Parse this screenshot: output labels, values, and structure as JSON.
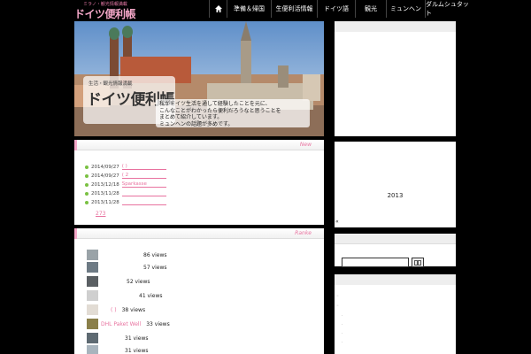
{
  "header": {
    "logo_sub": "ミラノ・観光情報満載",
    "logo_main": "ドイツ便利帳",
    "nav": [
      {
        "label": "準備＆帰国"
      },
      {
        "label": "生便利活情報"
      },
      {
        "label": "ドイツ語"
      },
      {
        "label": "観光"
      },
      {
        "label": "ミュンヘン"
      },
      {
        "label": "ダルムシュタット"
      }
    ]
  },
  "hero": {
    "logo_sub": "生活・観光情報満載",
    "logo_main": "ドイツ便利帳",
    "text_lines": [
      "私がドイツ生活を通して経験したことを元に、",
      "こんなことがわかったら便利だろうなと思うことを",
      "まとめて紹介しています。",
      "ミュンヘンの話題が多めです。"
    ]
  },
  "new_panel": {
    "title": "New",
    "items": [
      {
        "date": "2014/09/27",
        "link": "(          )"
      },
      {
        "date": "2014/09/27",
        "link": "(          2"
      },
      {
        "date": "2013/12/18",
        "link": "Sparkasse"
      },
      {
        "date": "2013/11/28",
        "link": ""
      },
      {
        "date": "2013/11/28",
        "link": ""
      }
    ],
    "more": "273"
  },
  "rank_panel": {
    "title": "Ranke",
    "rows": [
      {
        "title": "",
        "views": "86 views"
      },
      {
        "title": "",
        "views": "57 views"
      },
      {
        "title": "",
        "views": "52 views"
      },
      {
        "title": "",
        "views": "41 views"
      },
      {
        "title": "(    )",
        "views": "38 views"
      },
      {
        "title": "DHL Paket Well",
        "views": "33 views"
      },
      {
        "title": "",
        "views": "31 views"
      },
      {
        "title": "",
        "views": "31 views"
      }
    ]
  },
  "sidebar": {
    "calendar_year": "2013",
    "calendar_mark": "«",
    "search_placeholder": ""
  },
  "colors": {
    "accent_pink": "#e8729f",
    "dot_green": "#7ac142"
  }
}
